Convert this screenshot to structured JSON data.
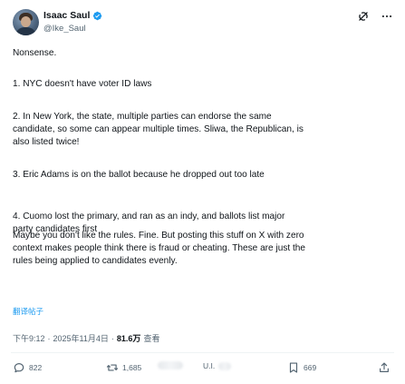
{
  "author": {
    "name": "Isaac Saul",
    "handle": "@Ike_Saul",
    "verified_color": "#1d9bf0"
  },
  "header_actions": {
    "grok_icon": "grok-icon",
    "more_icon": "more-horizontal-icon"
  },
  "post": {
    "paragraphs": [
      [
        "Nonsense."
      ],
      [
        "1. NYC doesn't have voter ID laws"
      ],
      [
        "2. In New York, the state, multiple parties can endorse the same",
        "candidate, so some can appear multiple times. Sliwa, the Republican, is",
        "also listed twice!"
      ],
      [
        "3. Eric Adams is on the ballot because he dropped out too late"
      ],
      [
        "4. Cuomo lost the primary, and ran as an indy, and ballots list major",
        "party candidates first"
      ],
      [
        "Maybe you don't like the rules. Fine. But posting this stuff on X with zero",
        "context makes people think there is fraud or cheating. These are just the",
        "rules being applied to candidates evenly."
      ]
    ],
    "translate_label": "翻译帖子"
  },
  "meta": {
    "time": "下午9:12",
    "separator": "·",
    "date": "2025年11月4日",
    "views": "81.6万",
    "views_label": "查看"
  },
  "actions": {
    "replies": "822",
    "reposts": "1,685",
    "likes": "U.I.",
    "bookmarks": "669"
  },
  "colors": {
    "text": "#0f1419",
    "secondary": "#536471",
    "link": "#1d9bf0",
    "divider": "#eff3f4"
  }
}
